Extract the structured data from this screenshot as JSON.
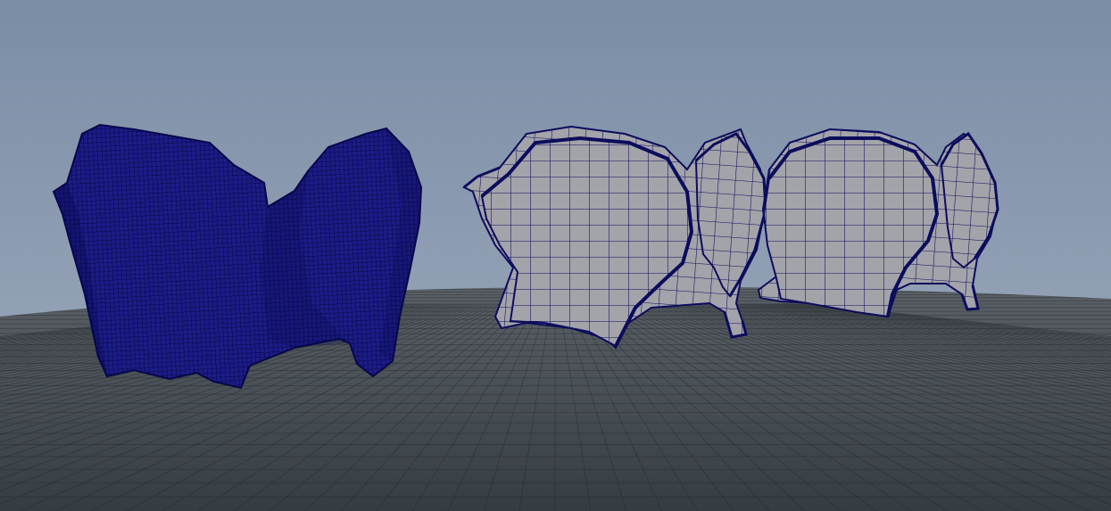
{
  "viewport": {
    "colors": {
      "sky_top": "#7b8da6",
      "sky_horizon": "#a1adbf",
      "ground_near": "#353c42",
      "ground_far": "#5a6066",
      "grid_line": "#1e2226",
      "high_poly_fill": "#1c1c86",
      "high_poly_wire": "#06064a",
      "low_poly_fill": "#a3a3aa",
      "low_poly_wire": "#0c0c5c"
    }
  },
  "objects": [
    {
      "name": "high-poly-armor-piece",
      "wireframe_density": "dense"
    },
    {
      "name": "low-poly-armor-piece-1",
      "wireframe_density": "sparse"
    },
    {
      "name": "low-poly-armor-piece-2",
      "wireframe_density": "sparse"
    }
  ]
}
